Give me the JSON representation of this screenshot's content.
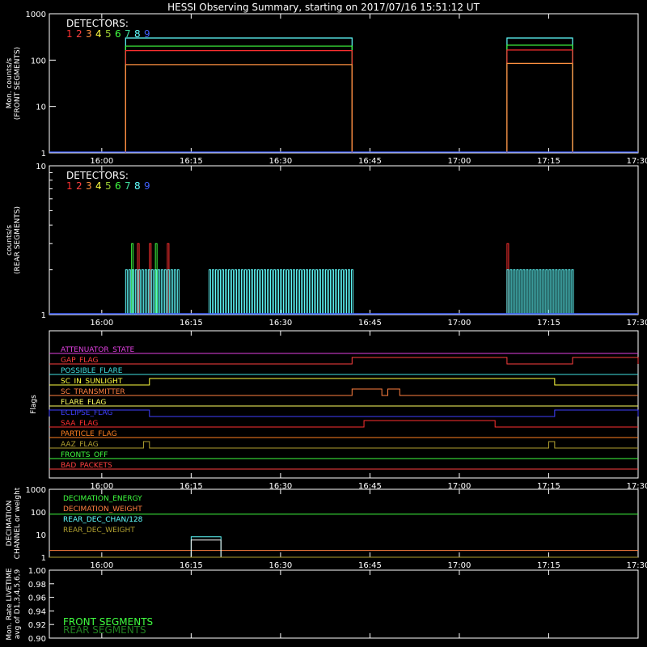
{
  "title": "HESSI Observing Summary, starting on 2017/07/16 15:51:12 UT",
  "time_axis": {
    "start": "15:51:12",
    "end": "17:30",
    "tick_labels": [
      "16:00",
      "16:15",
      "16:30",
      "16:45",
      "17:00",
      "17:15",
      "17:30"
    ]
  },
  "detector_legend": {
    "title": "DETECTORS:",
    "items": [
      {
        "label": "1",
        "color": "#ff3030"
      },
      {
        "label": "2",
        "color": "#ff4040"
      },
      {
        "label": "3",
        "color": "#ff9040"
      },
      {
        "label": "4",
        "color": "#ffff40"
      },
      {
        "label": "5",
        "color": "#9acd32"
      },
      {
        "label": "6",
        "color": "#40ff40"
      },
      {
        "label": "7",
        "color": "#40e0a0"
      },
      {
        "label": "8",
        "color": "#60ffff"
      },
      {
        "label": "9",
        "color": "#4060ff"
      }
    ]
  },
  "chart_data": [
    {
      "type": "line",
      "panel": "front",
      "ylabel": "Mon. counts/s\n(FRONT SEGMENTS)",
      "ylim": [
        1,
        1000
      ],
      "yscale": "log",
      "y_tick_labels": [
        "1",
        "10",
        "100",
        "1000"
      ],
      "series": [
        {
          "name": "8",
          "color": "#60ffff",
          "segments": [
            {
              "x": [
                "16:04",
                "16:42"
              ],
              "y": [
                300,
                300
              ]
            },
            {
              "x": [
                "17:08",
                "17:19"
              ],
              "y": [
                300,
                300
              ]
            }
          ]
        },
        {
          "name": "6",
          "color": "#40ff40",
          "segments": [
            {
              "x": [
                "16:04",
                "16:42"
              ],
              "y": [
                200,
                200
              ]
            },
            {
              "x": [
                "17:08",
                "17:19"
              ],
              "y": [
                210,
                210
              ]
            }
          ]
        },
        {
          "name": "1",
          "color": "#ff3030",
          "segments": [
            {
              "x": [
                "16:04",
                "16:42"
              ],
              "y": [
                160,
                160
              ]
            },
            {
              "x": [
                "17:08",
                "17:19"
              ],
              "y": [
                165,
                165
              ]
            }
          ]
        },
        {
          "name": "3",
          "color": "#ff9040",
          "segments": [
            {
              "x": [
                "16:04",
                "16:42"
              ],
              "y": [
                80,
                80
              ]
            },
            {
              "x": [
                "17:08",
                "17:19"
              ],
              "y": [
                85,
                85
              ]
            }
          ]
        },
        {
          "name": "9",
          "color": "#4060ff",
          "segments": [
            {
              "x": [
                "15:51:12",
                "17:30"
              ],
              "y": [
                1,
                1
              ]
            }
          ]
        }
      ]
    },
    {
      "type": "line",
      "panel": "rear",
      "ylabel": "counts/s\n(REAR SEGMENTS)",
      "ylim": [
        1,
        10
      ],
      "yscale": "log",
      "y_tick_labels": [
        "1",
        "10"
      ],
      "series": [
        {
          "name": "1",
          "color": "#ff3030",
          "spikes": [
            {
              "x": "16:06",
              "y": 3
            },
            {
              "x": "16:08",
              "y": 3
            },
            {
              "x": "16:11",
              "y": 3
            },
            {
              "x": "17:08",
              "y": 3
            }
          ]
        },
        {
          "name": "6",
          "color": "#40ff40",
          "spikes": [
            {
              "x": "16:05",
              "y": 3
            },
            {
              "x": "16:09",
              "y": 3
            }
          ]
        },
        {
          "name": "8",
          "color": "#60ffff",
          "spike_ranges": [
            {
              "from": "16:04",
              "to": "16:13",
              "y": 2
            },
            {
              "from": "16:18",
              "to": "16:42",
              "y": 2
            },
            {
              "from": "17:08",
              "to": "17:19",
              "y": 2
            }
          ]
        },
        {
          "name": "9",
          "color": "#4060ff",
          "segments": [
            {
              "x": [
                "15:51:12",
                "17:30"
              ],
              "y": [
                1,
                1
              ]
            }
          ]
        }
      ]
    },
    {
      "type": "line",
      "panel": "flags",
      "ylabel": "Flags",
      "flags": [
        {
          "label": "ATTENUATOR_STATE",
          "color": "#e040e0",
          "on": []
        },
        {
          "label": "GAP_FLAG",
          "color": "#ff4040",
          "on": [
            [
              "16:42",
              "17:08"
            ],
            [
              "17:19",
              "17:30"
            ]
          ]
        },
        {
          "label": "POSSIBLE_FLARE",
          "color": "#40e0e0",
          "on": []
        },
        {
          "label": "SC_IN_SUNLIGHT",
          "color": "#ffff40",
          "on": [
            [
              "16:08",
              "17:16"
            ]
          ]
        },
        {
          "label": "SC_TRANSMITTER",
          "color": "#ff8040",
          "on": [
            [
              "16:42",
              "16:47"
            ],
            [
              "16:48",
              "16:50"
            ]
          ]
        },
        {
          "label": "FLARE_FLAG",
          "color": "#ffff60",
          "on": []
        },
        {
          "label": "ECLIPSE_FLAG",
          "color": "#4040ff",
          "on": [
            [
              "15:51:12",
              "16:08"
            ],
            [
              "17:16",
              "17:30"
            ]
          ]
        },
        {
          "label": "SAA_FLAG",
          "color": "#ff3030",
          "on": [
            [
              "16:44",
              "17:06"
            ]
          ]
        },
        {
          "label": "PARTICLE_FLAG",
          "color": "#ff8020",
          "on": []
        },
        {
          "label": "AAZ_FLAG",
          "color": "#b0a030",
          "on": [
            [
              "16:07",
              "16:08"
            ],
            [
              "17:15",
              "17:16"
            ]
          ]
        },
        {
          "label": "FRONTS_OFF",
          "color": "#40ff40",
          "on": []
        },
        {
          "label": "BAD_PACKETS",
          "color": "#ff4040",
          "on": []
        }
      ]
    },
    {
      "type": "line",
      "panel": "decimation",
      "ylabel": "DECIMATION\nCHANNEL or weight",
      "ylim": [
        1,
        1000
      ],
      "yscale": "log",
      "y_tick_labels": [
        "1",
        "10",
        "100",
        "1000"
      ],
      "series": [
        {
          "name": "DECIMATION_ENERGY",
          "color": "#40ff40",
          "segments": [
            {
              "x": [
                "15:51:12",
                "17:30"
              ],
              "y": [
                80,
                80
              ]
            }
          ]
        },
        {
          "name": "DECIMATION_WEIGHT",
          "color": "#ff8040",
          "segments": [
            {
              "x": [
                "15:51:12",
                "17:30"
              ],
              "y": [
                2,
                2
              ]
            }
          ]
        },
        {
          "name": "REAR_DEC_CHAN/128",
          "color": "#60ffff",
          "segments": [
            {
              "x": [
                "16:15",
                "16:20"
              ],
              "y": [
                8,
                8
              ]
            }
          ]
        },
        {
          "name": "REAR_DEC_WEIGHT",
          "color": "#b0a030",
          "segments": [
            {
              "x": [
                "15:51:12",
                "17:30"
              ],
              "y": [
                1,
                1
              ]
            }
          ]
        }
      ]
    },
    {
      "type": "line",
      "panel": "livetime",
      "ylabel": "Mon. Rate LIVETIME\navg of D1,3,4,5,6,9",
      "ylim": [
        0.9,
        1.0
      ],
      "y_tick_labels": [
        "0.90",
        "0.92",
        "0.94",
        "0.96",
        "0.98",
        "1.00"
      ],
      "series": [
        {
          "name": "FRONT SEGMENTS",
          "color": "#40ff40",
          "values": []
        },
        {
          "name": "REAR SEGMENTS",
          "color": "#208020",
          "values": []
        }
      ]
    }
  ]
}
